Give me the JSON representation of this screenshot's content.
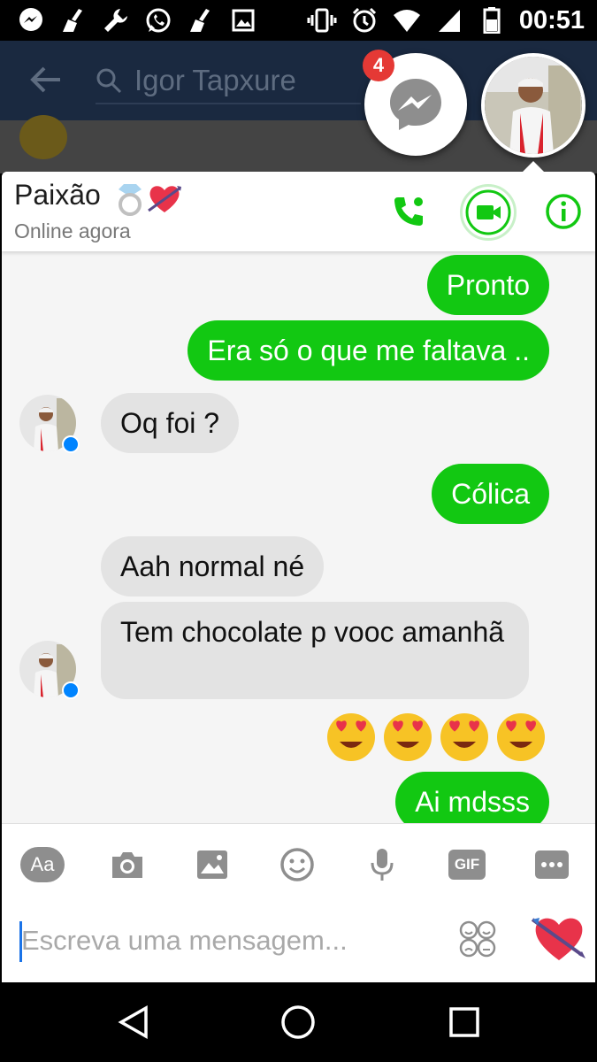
{
  "status_bar": {
    "time": "00:51",
    "left_icons": [
      "messenger-icon",
      "broom-icon",
      "wrench-icon",
      "whatsapp-icon",
      "broom-icon",
      "image-icon"
    ],
    "right_icons": [
      "vibrate-icon",
      "alarm-icon",
      "wifi-icon",
      "signal-icon",
      "battery-icon"
    ]
  },
  "background_app": {
    "search_placeholder": "Igor Tapxure"
  },
  "chat_heads": {
    "unread_count": "4"
  },
  "chat": {
    "contact_name": "Paixão",
    "contact_name_emojis": [
      "ring-emoji",
      "heart-arrow-emoji"
    ],
    "status": "Online agora",
    "header_icons": [
      "phone-icon",
      "video-icon",
      "info-icon"
    ],
    "accent_color": "#12c812",
    "messages": [
      {
        "side": "out",
        "text": "Pronto"
      },
      {
        "side": "out",
        "text": "Era só o que me faltava .."
      },
      {
        "side": "in",
        "text": "Oq foi ?"
      },
      {
        "side": "out",
        "text": "Cólica"
      },
      {
        "side": "in",
        "text": "Aah normal né"
      },
      {
        "side": "in",
        "text": "Tem chocolate p vooc amanhã"
      },
      {
        "side": "out",
        "text": "😍😍😍😍"
      },
      {
        "side": "out",
        "text": "Ai mdsss"
      }
    ]
  },
  "composer": {
    "aa_label": "Aa",
    "gif_label": "GIF",
    "tools": [
      "text-style-button",
      "camera-icon",
      "gallery-icon",
      "emoji-icon",
      "mic-icon",
      "gif-button",
      "more-icon"
    ],
    "placeholder": "Escreva uma mensagem..."
  },
  "nav_bar": {
    "buttons": [
      "back-icon",
      "home-icon",
      "recents-icon"
    ]
  }
}
